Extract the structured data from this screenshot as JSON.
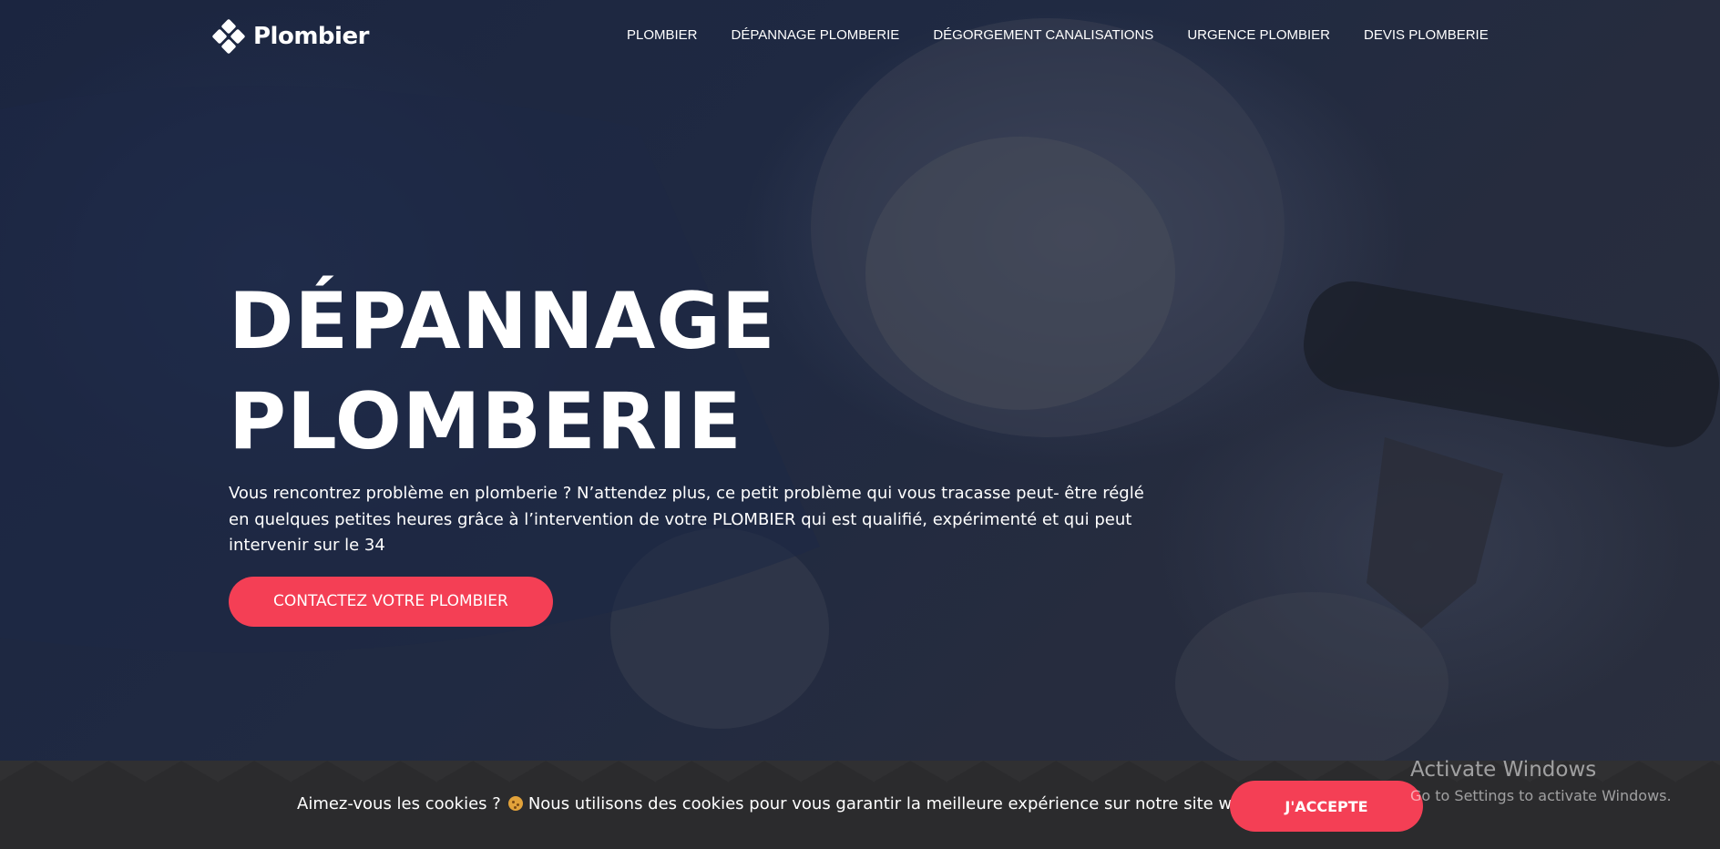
{
  "brand": {
    "name": "Plombier",
    "logo_icon": "diamond-cluster-icon"
  },
  "nav": {
    "items": [
      {
        "label": "PLOMBIER"
      },
      {
        "label": "DÉPANNAGE PLOMBERIE"
      },
      {
        "label": "DÉGORGEMENT CANALISATIONS"
      },
      {
        "label": "URGENCE PLOMBIER"
      },
      {
        "label": "DEVIS PLOMBERIE"
      }
    ]
  },
  "hero": {
    "title_line1": "DÉPANNAGE",
    "title_line2": "PLOMBERIE",
    "text": "Vous rencontrez problème en plomberie ? N’attendez plus, ce petit problème qui vous tracasse peut- être réglé en quelques petites heures grâce à l’intervention de votre PLOMBIER qui est qualifié, expérimenté et qui peut intervenir sur le 34",
    "cta_label": "CONTACTEZ VOTRE PLOMBIER"
  },
  "cookie_banner": {
    "question": "Aimez-vous les cookies ?",
    "emoji": "cookie-icon",
    "message": "Nous utilisons des cookies pour vous garantir la meilleure expérience sur notre site web.",
    "accept_label": "J'ACCEPTE"
  },
  "os_watermark": {
    "title": "Activate Windows",
    "subtitle": "Go to Settings to activate Windows."
  },
  "colors": {
    "accent": "#f43f55",
    "hero_overlay": "#1c2335",
    "cookie_bar": "#2b2b2d",
    "text": "#ffffff"
  }
}
